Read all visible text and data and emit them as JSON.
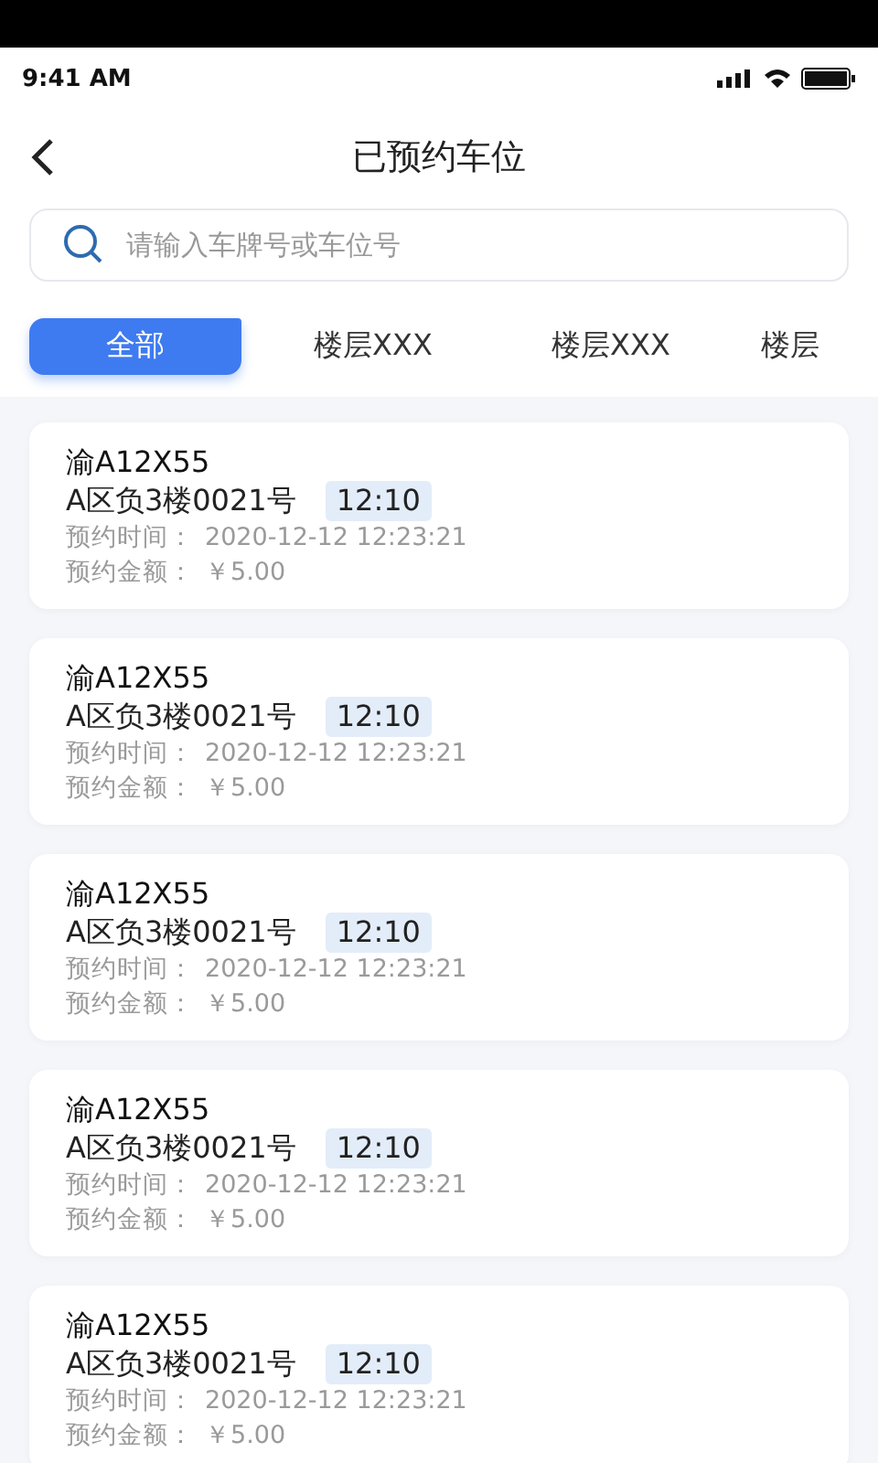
{
  "status_bar": {
    "time": "9:41 AM"
  },
  "header": {
    "title": "已预约车位"
  },
  "search": {
    "placeholder": "请输入车牌号或车位号"
  },
  "tabs": [
    {
      "label": "全部",
      "selected": true
    },
    {
      "label": "楼层XXX",
      "selected": false
    },
    {
      "label": "楼层XXX",
      "selected": false
    },
    {
      "label": "楼层",
      "selected": false
    }
  ],
  "reservations": [
    {
      "plate": "渝A12X55",
      "space": "A区负3楼0021号",
      "duration": "12:10",
      "time_label": "预约时间：",
      "time": "2020-12-12 12:23:21",
      "amount_label": "预约金额：",
      "amount": "￥5.00"
    },
    {
      "plate": "渝A12X55",
      "space": "A区负3楼0021号",
      "duration": "12:10",
      "time_label": "预约时间：",
      "time": "2020-12-12 12:23:21",
      "amount_label": "预约金额：",
      "amount": "￥5.00"
    },
    {
      "plate": "渝A12X55",
      "space": "A区负3楼0021号",
      "duration": "12:10",
      "time_label": "预约时间：",
      "time": "2020-12-12 12:23:21",
      "amount_label": "预约金额：",
      "amount": "￥5.00"
    },
    {
      "plate": "渝A12X55",
      "space": "A区负3楼0021号",
      "duration": "12:10",
      "time_label": "预约时间：",
      "time": "2020-12-12 12:23:21",
      "amount_label": "预约金额：",
      "amount": "￥5.00"
    },
    {
      "plate": "渝A12X55",
      "space": "A区负3楼0021号",
      "duration": "12:10",
      "time_label": "预约时间：",
      "time": "2020-12-12 12:23:21",
      "amount_label": "预约金额：",
      "amount": "￥5.00"
    }
  ]
}
